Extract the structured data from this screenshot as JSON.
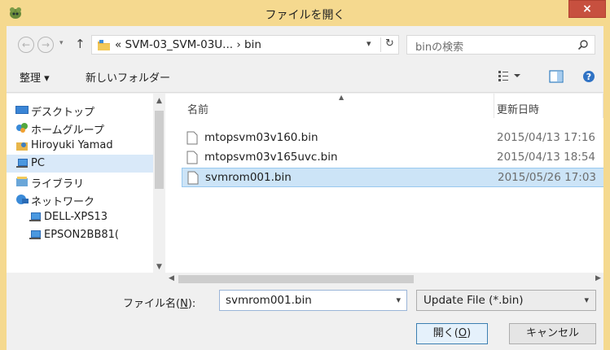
{
  "window": {
    "title": "ファイルを開く",
    "close_label": "×"
  },
  "nav": {
    "back_icon": "←",
    "forward_icon": "→",
    "up_icon": "↑",
    "dropdown_glyph": "▾",
    "address": "«  SVM-03_SVM-03U...  ›  bin",
    "refresh_icon": "↻",
    "search_placeholder": "binの検索"
  },
  "toolbar": {
    "organize_label": "整理 ▾",
    "new_folder_label": "新しいフォルダー"
  },
  "sidebar": {
    "items": [
      {
        "label": "デスクトップ",
        "icon": "desktop-icon"
      },
      {
        "label": "ホームグループ",
        "icon": "homegroup-icon"
      },
      {
        "label": "Hiroyuki Yamad",
        "icon": "user-folder-icon"
      },
      {
        "label": "PC",
        "icon": "pc-icon",
        "selected": true
      },
      {
        "label": "ライブラリ",
        "icon": "library-icon"
      },
      {
        "label": "ネットワーク",
        "icon": "network-icon"
      },
      {
        "label": "DELL-XPS13",
        "icon": "computer-icon"
      },
      {
        "label": "EPSON2BB81(",
        "icon": "computer-icon"
      }
    ]
  },
  "columns": {
    "name": "名前",
    "date": "更新日時"
  },
  "files": [
    {
      "name": "mtopsvm03v160.bin",
      "date": "2015/04/13 17:16"
    },
    {
      "name": "mtopsvm03v165uvc.bin",
      "date": "2015/04/13 18:54"
    },
    {
      "name": "svmrom001.bin",
      "date": "2015/05/26 17:03",
      "selected": true
    }
  ],
  "footer": {
    "filename_label_pre": "ファイル名(",
    "filename_label_key": "N",
    "filename_label_post": "):",
    "filename_value": "svmrom001.bin",
    "filetype_value": "Update File (*.bin)",
    "open_pre": "開く(",
    "open_key": "O",
    "open_post": ")",
    "cancel_label": "キャンセル"
  },
  "colors": {
    "title_bar": "#f5d98f",
    "close_button": "#c7503f",
    "selection": "#cce4f7"
  }
}
